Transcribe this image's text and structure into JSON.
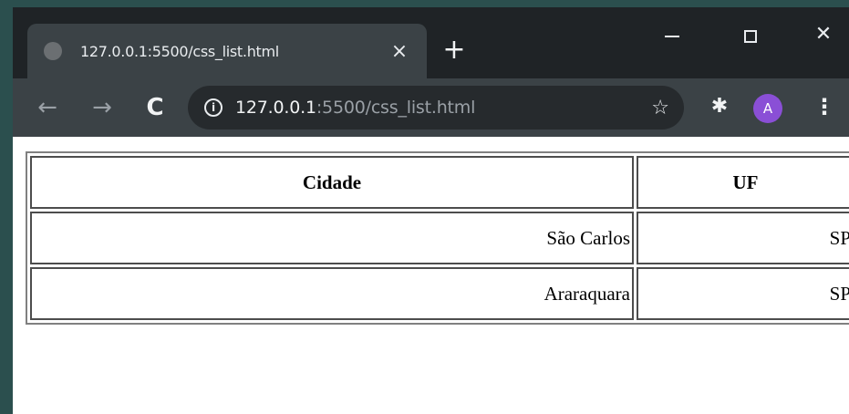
{
  "browser": {
    "tab": {
      "title": "127.0.0.1:5500/css_list.html",
      "close_glyph": "×"
    },
    "newtab_glyph": "+",
    "window_controls": {
      "close_glyph": "✕"
    },
    "toolbar": {
      "back_glyph": "←",
      "forward_glyph": "→",
      "reload_glyph": "C",
      "info_glyph": "i",
      "url_host": "127.0.0.1",
      "url_rest": ":5500/css_list.html",
      "star_glyph": "☆",
      "extensions_glyph": "✱",
      "avatar_letter": "A",
      "menu_glyph": "⋮"
    },
    "colors": {
      "frame": "#1f2326",
      "toolbar": "#3b4246",
      "avatar": "#8a4fd6"
    }
  },
  "page": {
    "table": {
      "headers": [
        "Cidade",
        "UF"
      ],
      "rows": [
        [
          "São Carlos",
          "SP"
        ],
        [
          "Araraquara",
          "SP"
        ]
      ]
    }
  }
}
